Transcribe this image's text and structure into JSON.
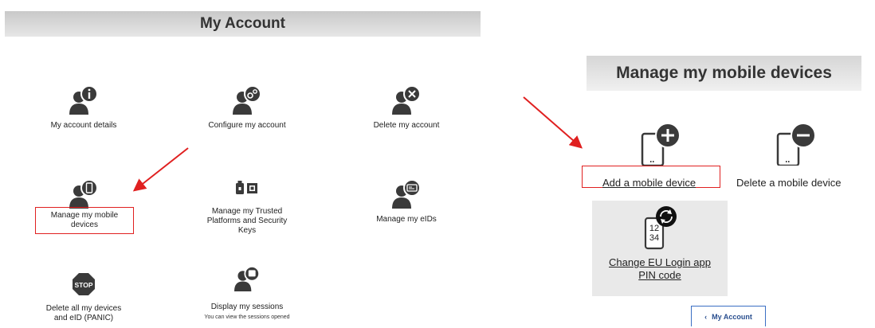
{
  "left": {
    "header": "My Account",
    "tiles": {
      "account_details": "My account details",
      "configure": "Configure my account",
      "delete_account": "Delete my account",
      "mobile_devices_line1": "Manage my mobile",
      "mobile_devices_line2": "devices",
      "trusted_line1": "Manage my Trusted",
      "trusted_line2": "Platforms and Security",
      "trusted_line3": "Keys",
      "eids": "Manage my eIDs",
      "panic_line1": "Delete all my devices",
      "panic_line2": "and eID (PANIC)",
      "sessions": "Display my sessions",
      "sessions_sub": "You can view the sessions opened"
    },
    "stop_text": "STOP"
  },
  "right": {
    "header": "Manage my mobile devices",
    "add_device": "Add a mobile device",
    "delete_device": "Delete a mobile device",
    "pin_line1": "Change EU Login app",
    "pin_line2": "PIN code",
    "pin_digits_1": "12",
    "pin_digits_2": "34",
    "back_label": "My Account"
  },
  "colors": {
    "annotation_red": "#e02020",
    "back_blue": "#3b6fc4"
  },
  "icons": [
    "user-info-icon",
    "user-gear-icon",
    "user-delete-icon",
    "user-mobile-icon",
    "security-keys-icon",
    "user-eid-icon",
    "stop-sign-icon",
    "user-sessions-icon",
    "mobile-add-icon",
    "mobile-remove-icon",
    "mobile-pin-icon",
    "chevron-left-icon"
  ]
}
